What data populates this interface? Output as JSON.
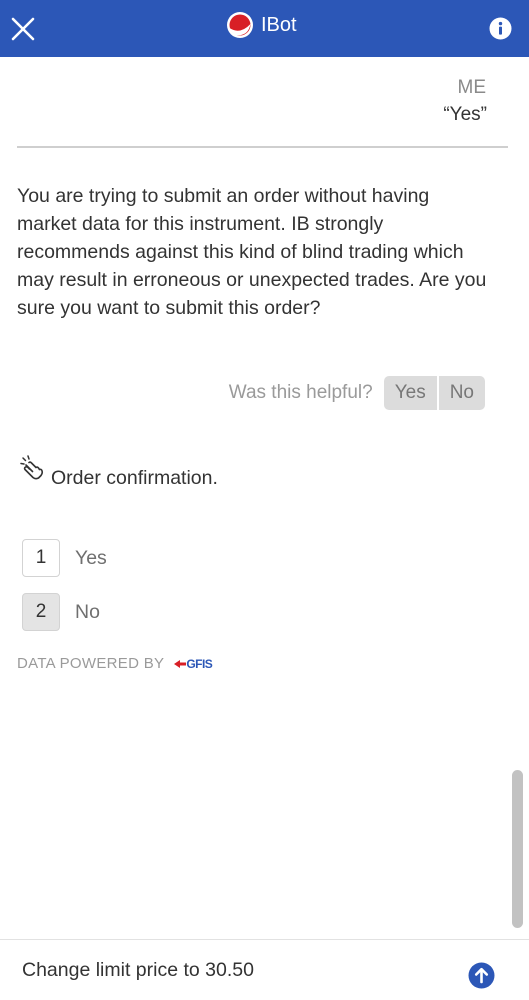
{
  "header": {
    "title": "IBot",
    "close_icon": "close-icon",
    "info_icon": "info-icon",
    "background_color": "#2c57b7"
  },
  "conversation": {
    "user_label": "ME",
    "user_message": "“Yes”",
    "bot_message": "You are trying to submit an order without having market data for this instrument. IB strongly recommends against this kind of blind trading which may result in erroneous or unexpected trades. Are you sure you want to submit this order?",
    "feedback": {
      "label": "Was this helpful?",
      "yes": "Yes",
      "no": "No"
    },
    "prompt_icon": "hand-tap-icon",
    "prompt": "Order confirmation.",
    "options": [
      {
        "number": "1",
        "label": "Yes"
      },
      {
        "number": "2",
        "label": "No",
        "selected": true
      }
    ],
    "powered_by": "DATA POWERED BY",
    "provider": "GFIS"
  },
  "input": {
    "value": "Change limit price to 30.50",
    "send_icon": "arrow-up-circle-icon",
    "accent_color": "#2c57b7"
  }
}
